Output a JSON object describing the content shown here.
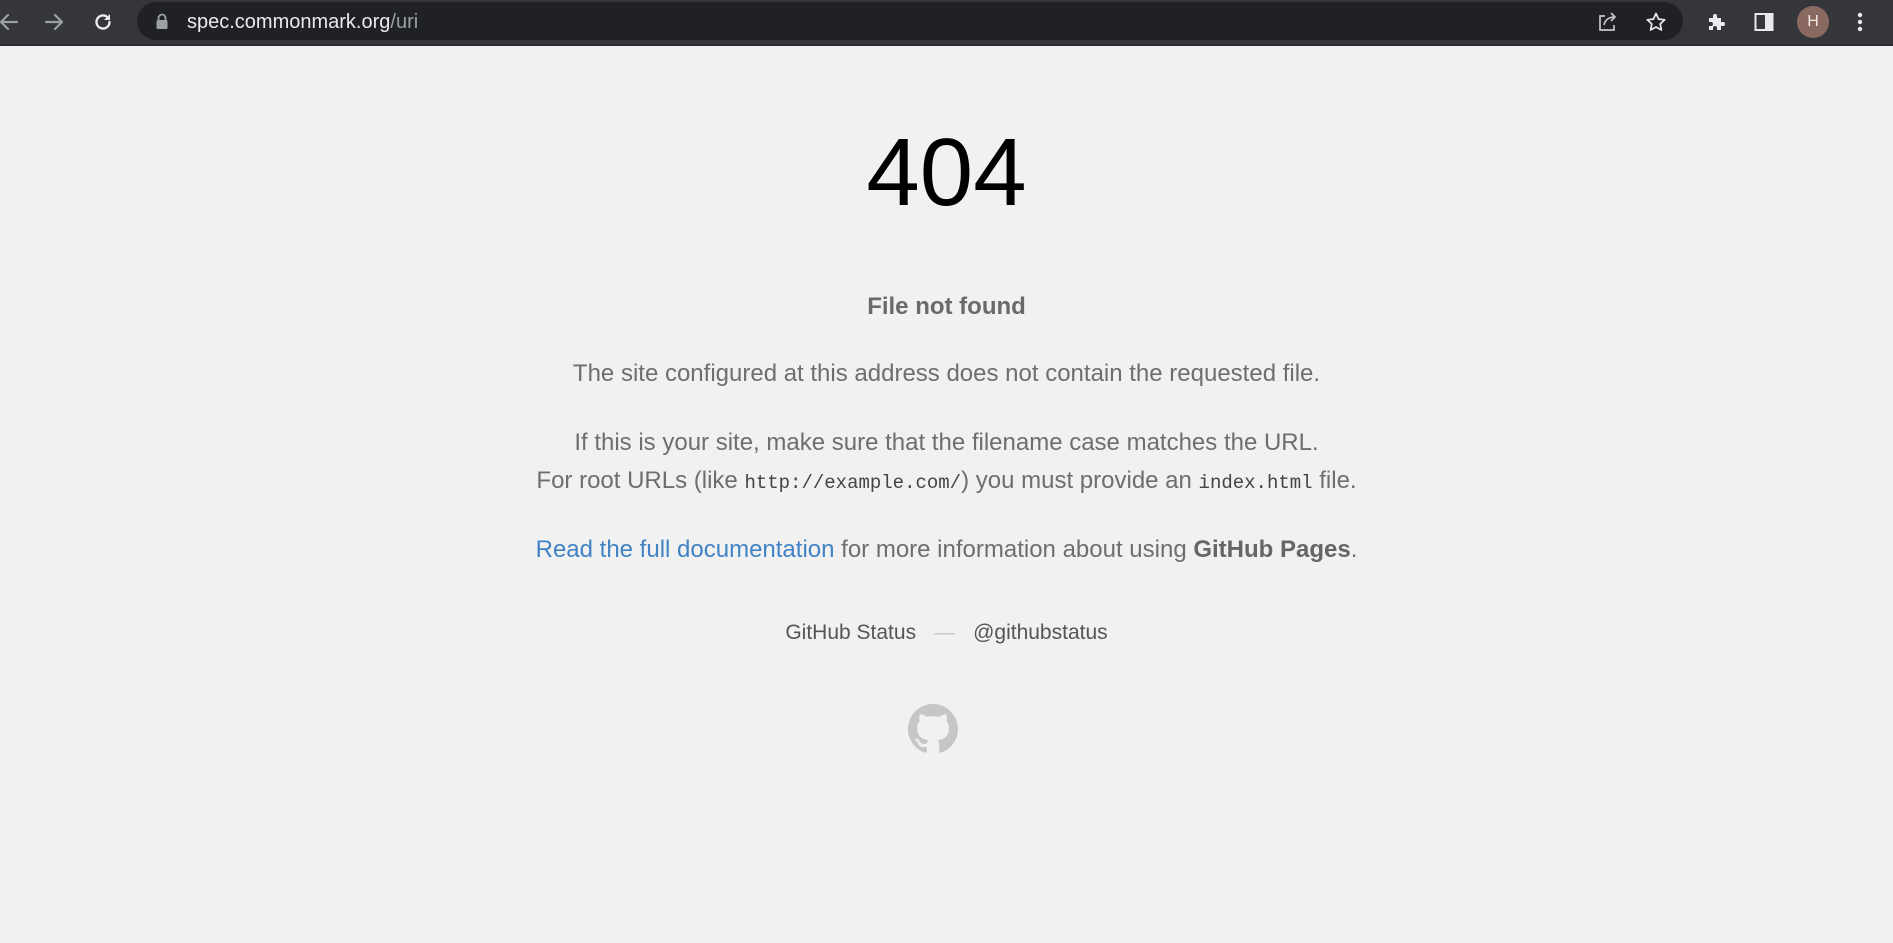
{
  "browser": {
    "url_host": "spec.commonmark.org",
    "url_path": "/uri",
    "avatar_initial": "H",
    "icons": {
      "back": "arrow-left-icon",
      "forward": "arrow-right-icon",
      "reload": "reload-icon",
      "lock": "lock-icon",
      "share": "share-icon",
      "bookmark": "star-icon",
      "extensions": "puzzle-icon",
      "side_panel": "side-panel-icon",
      "menu": "kebab-menu-icon"
    }
  },
  "page": {
    "code": "404",
    "subtitle": "File not found",
    "p1": "The site configured at this address does not contain the requested file.",
    "p2_line1": "If this is your site, make sure that the filename case matches the URL.",
    "p2_line2_a": "For root URLs (like ",
    "p2_code1": "http://example.com/",
    "p2_line2_b": ") you must provide an ",
    "p2_code2": "index.html",
    "p2_line2_c": " file.",
    "doc_link": "Read the full documentation",
    "doc_text": " for more information about using ",
    "doc_strong": "GitHub Pages",
    "doc_end": ".",
    "footer_status": "GitHub Status",
    "footer_dash": "—",
    "footer_twitter": "@githubstatus",
    "logo_icon": "github-octocat-icon"
  }
}
